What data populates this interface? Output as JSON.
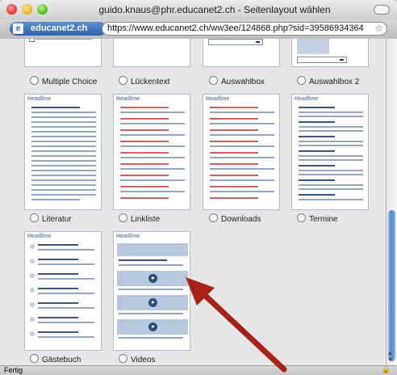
{
  "window": {
    "title": "guido.knaus@phr.educanet2.ch - Seitenlayout wählen",
    "site_label": "educanet2.ch",
    "url": "https://www.educanet2.ch/ww3ee/124868.php?sid=39586934364",
    "status": "Fertig"
  },
  "layouts": [
    {
      "label": "Multiple Choice",
      "headline": ""
    },
    {
      "label": "Lückentext",
      "headline": ""
    },
    {
      "label": "Auswahlbox",
      "headline": ""
    },
    {
      "label": "Auswahlbox 2",
      "headline": ""
    },
    {
      "label": "Literatur",
      "headline": "Headline"
    },
    {
      "label": "Linkliste",
      "headline": "Headline"
    },
    {
      "label": "Downloads",
      "headline": "Headline"
    },
    {
      "label": "Termine",
      "headline": "Headline"
    },
    {
      "label": "Gästebuch",
      "headline": "Headline"
    },
    {
      "label": "Videos",
      "headline": "Headline"
    }
  ],
  "icons": {
    "favicon": "educanet-icon",
    "bookmark": "star-icon",
    "lock": "lock-icon",
    "play": "play-icon"
  },
  "colors": {
    "accent": "#2f64ad",
    "annotation_arrow": "#a8221a",
    "red_lines": "#d05f5f"
  }
}
